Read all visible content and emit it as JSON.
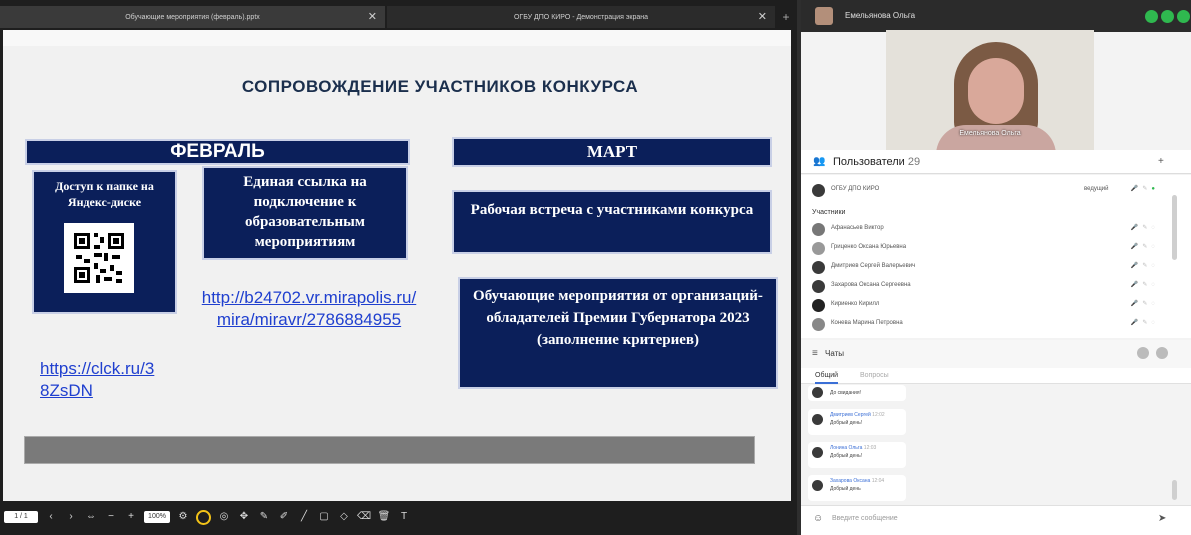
{
  "tabs": {
    "tab1_title": "Обучающие мероприятия (февраль).pptx",
    "tab2_title": "ОГБУ ДПО КИРО - Демонстрация экрана"
  },
  "slide": {
    "title": "СОПРОВОЖДЕНИЕ УЧАСТНИКОВ КОНКУРСА",
    "february": "ФЕВРАЛЬ",
    "yandex_box": "Доступ к папке на Яндекс-диске",
    "link_box": "Единая ссылка на подключение к образовательным мероприятиям",
    "url_long": "http://b24702.vr.mirapolis.ru/mira/miravr/2786884955",
    "url_short": "https://clck.ru/38ZsDN",
    "march": "МАРТ",
    "meeting_box": "Рабочая встреча с участниками конкурса",
    "training_box": "Обучающие мероприятия от организаций-обладателей Премии Губернатора 2023 (заполнение критериев)"
  },
  "toolbar": {
    "page": "1 / 1",
    "zoom": "100%"
  },
  "presenter": {
    "name": "Емельянова Ольга",
    "video_label": "Емельянова Ольга"
  },
  "users": {
    "title": "Пользователи",
    "count": "29",
    "host_name": "ОГБУ ДПО КИРО",
    "host_role": "ведущий",
    "section_label": "Участники",
    "participants": [
      "Афанасьев Виктор",
      "Гриценко Оксана Юрьевна",
      "Дмитриев Сергей Валерьевич",
      "Захарова Оксана Сергеевна",
      "Кириенко Кирилл",
      "Конева Марина Петровна"
    ]
  },
  "chat": {
    "title": "Чаты",
    "tab_general": "Общий",
    "tab_questions": "Вопросы",
    "messages": [
      {
        "name": "",
        "time": "",
        "text": "До свидания!"
      },
      {
        "name": "Дмитриев Сергей",
        "time": "12:02",
        "text": "Добрый день!"
      },
      {
        "name": "Лонина Ольга",
        "time": "12:03",
        "text": "Добрый день!"
      },
      {
        "name": "Захарова Оксана",
        "time": "12:04",
        "text": "Добрый день"
      }
    ],
    "input_placeholder": "Введите сообщение"
  },
  "colors": {
    "slide_navy": "#0b1f5a",
    "link_blue": "#1f3fcf",
    "control_green": "#2fb84f"
  }
}
